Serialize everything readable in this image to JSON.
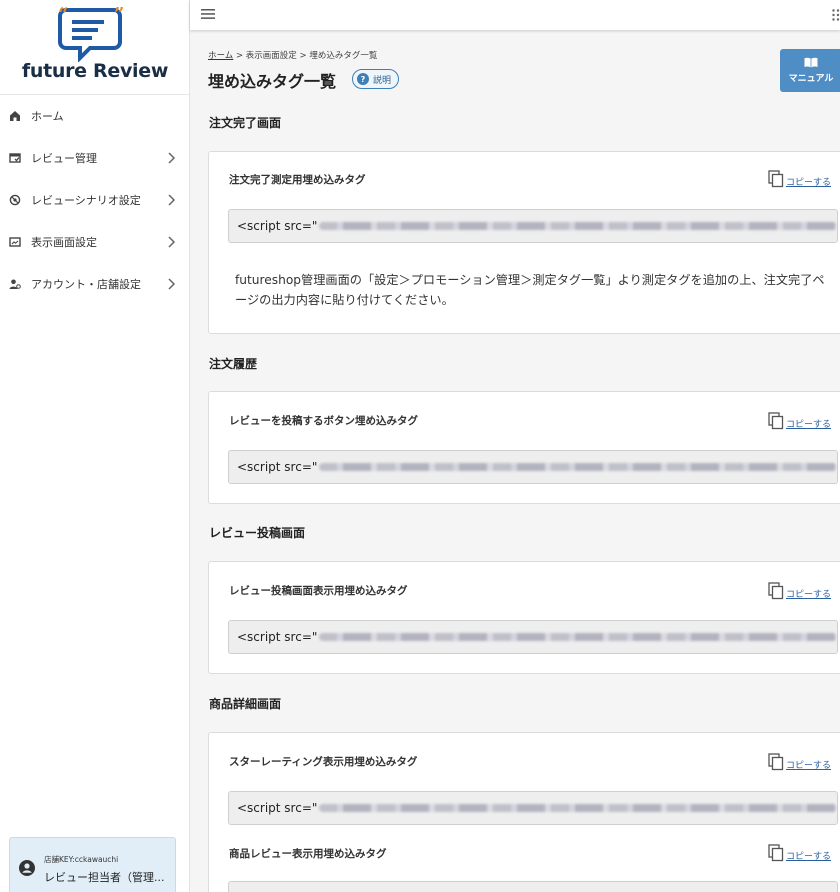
{
  "app": {
    "name": "future Review"
  },
  "sidebar": {
    "items": [
      {
        "label": "ホーム",
        "icon": "home-icon",
        "has_children": false
      },
      {
        "label": "レビュー管理",
        "icon": "review-manage-icon",
        "has_children": true
      },
      {
        "label": "レビューシナリオ設定",
        "icon": "scenario-icon",
        "has_children": true
      },
      {
        "label": "表示画面設定",
        "icon": "display-icon",
        "has_children": true
      },
      {
        "label": "アカウント・店舗設定",
        "icon": "account-icon",
        "has_children": true
      }
    ],
    "user": {
      "store_key": "店舗KEY:cckawauchi",
      "name": "レビュー担当者（管理..."
    }
  },
  "header": {
    "breadcrumb": {
      "home": "ホーム",
      "sep": ">",
      "parent": "表示画面設定",
      "current": "埋め込みタグ一覧"
    },
    "title": "埋め込みタグ一覧",
    "help_label": "説明",
    "manual_label": "マニュアル"
  },
  "copy_label": "コピーする",
  "code_prefix": "<script src=\"",
  "sections": [
    {
      "title": "注文完了画面",
      "tags": [
        {
          "label": "注文完了測定用埋め込みタグ"
        }
      ],
      "note": "futureshop管理画面の「設定＞プロモーション管理＞測定タグ一覧」より測定タグを追加の上、注文完了ページの出力内容に貼り付けてください。"
    },
    {
      "title": "注文履歴",
      "tags": [
        {
          "label": "レビューを投稿するボタン埋め込みタグ"
        }
      ]
    },
    {
      "title": "レビュー投稿画面",
      "tags": [
        {
          "label": "レビュー投稿画面表示用埋め込みタグ"
        }
      ]
    },
    {
      "title": "商品詳細画面",
      "tags": [
        {
          "label": "スターレーティング表示用埋め込みタグ"
        },
        {
          "label": "商品レビュー表示用埋め込みタグ"
        }
      ]
    }
  ],
  "colors": {
    "accent": "#4f8ec4",
    "logo_blue": "#1f5aa6",
    "logo_orange": "#f08a1d",
    "link": "#2a5fa0"
  }
}
